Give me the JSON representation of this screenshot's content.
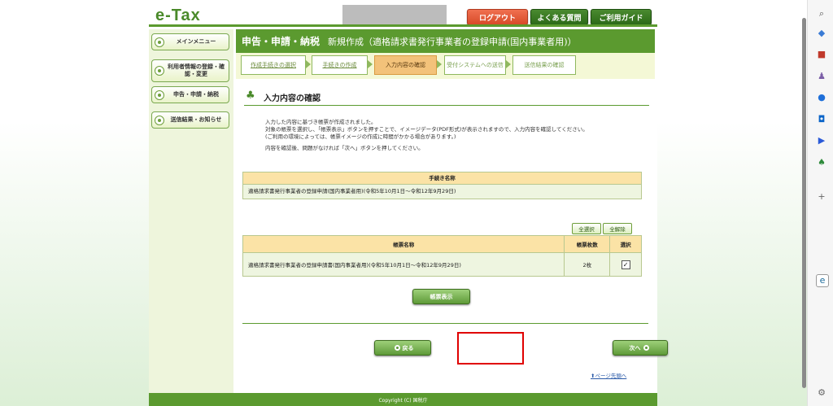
{
  "logo": "e-Tax",
  "header": {
    "logout": "ログアウト",
    "faq": "よくある質問",
    "guide": "ご利用ガイド"
  },
  "sidebar": {
    "items": [
      {
        "label": "メインメニュー"
      },
      {
        "label": "利用者情報の登録・確認・変更"
      },
      {
        "label": "申告・申請・納税"
      },
      {
        "label": "送信結果・お知らせ"
      }
    ]
  },
  "title": {
    "main": "申告・申請・納税",
    "sub": "新規作成（適格請求書発行事業者の登録申請(国内事業者用)）"
  },
  "steps": [
    {
      "label": "作成手続きの選択"
    },
    {
      "label": "手続きの作成"
    },
    {
      "label": "入力内容の確認"
    },
    {
      "label": "受付システムへの送信"
    },
    {
      "label": "送信結果の確認"
    }
  ],
  "section_title": "入力内容の確認",
  "description": {
    "line1": "入力した内容に基づき帳票が作成されました。",
    "line2": "対象の帳票を選択し、「帳票表示」ボタンを押すことで、イメージデータ(PDF形式)が表示されますので、入力内容を確認してください。",
    "line3": "(ご利用の環境によっては、帳票イメージの作成に時間がかかる場合があります。)",
    "line4": "内容を確認後、問題がなければ「次へ」ボタンを押してください。"
  },
  "procedure_table": {
    "header": "手続き名称",
    "value": "適格請求書発行事業者の登録申請(国内事業者用)(令和5年10月1日～令和12年9月29日)"
  },
  "select_all": "全選択",
  "deselect_all": "全解除",
  "form_table": {
    "headers": [
      "帳票名称",
      "帳票枚数",
      "選択"
    ],
    "rows": [
      {
        "name": "適格請求書発行事業者の登録申請書(国内事業者用)(令和5年10月1日～令和12年9月29日)",
        "count": "2枚",
        "selected": "✓"
      }
    ]
  },
  "show_form_button": "帳票表示",
  "back_button": "戻る",
  "next_button": "次へ",
  "page_top": "ページ先頭へ",
  "footer": "Copyright (C) 国税庁",
  "colors": {
    "brand_green": "#5b9a2f",
    "accent_orange": "#f3c27a",
    "highlight_red": "#e00000"
  }
}
